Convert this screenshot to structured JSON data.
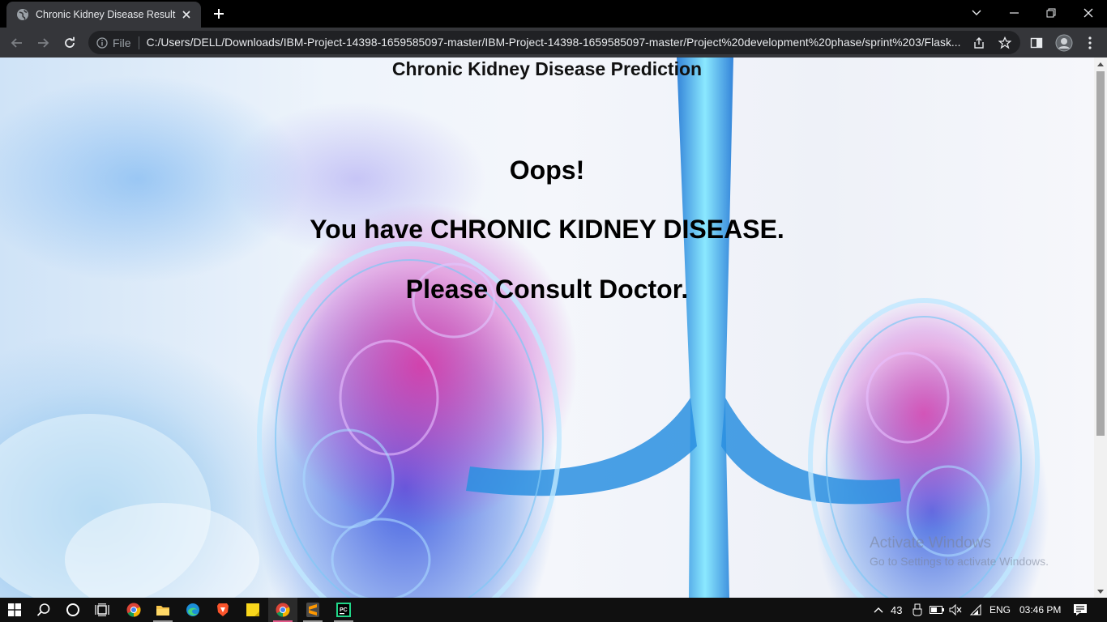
{
  "browser": {
    "tab_title": "Chronic Kidney Disease Result",
    "file_label": "File",
    "url": "C:/Users/DELL/Downloads/IBM-Project-14398-1659585097-master/IBM-Project-14398-1659585097-master/Project%20development%20phase/sprint%203/Flask..."
  },
  "page": {
    "heading": "Chronic Kidney Disease Prediction",
    "result_line_1": "Oops!",
    "result_line_2": "You have CHRONIC KIDNEY DISEASE.",
    "result_line_3": "Please Consult Doctor."
  },
  "watermark": {
    "line1": "Activate Windows",
    "line2": "Go to Settings to activate Windows."
  },
  "taskbar": {
    "temperature": "43",
    "language": "ENG",
    "time": "03:46 PM"
  },
  "colors": {
    "titlebar": "#000000",
    "toolbar": "#35363a",
    "omnibox": "#202124",
    "taskbar": "#101010",
    "active_app_accent": "#e35b8a"
  }
}
